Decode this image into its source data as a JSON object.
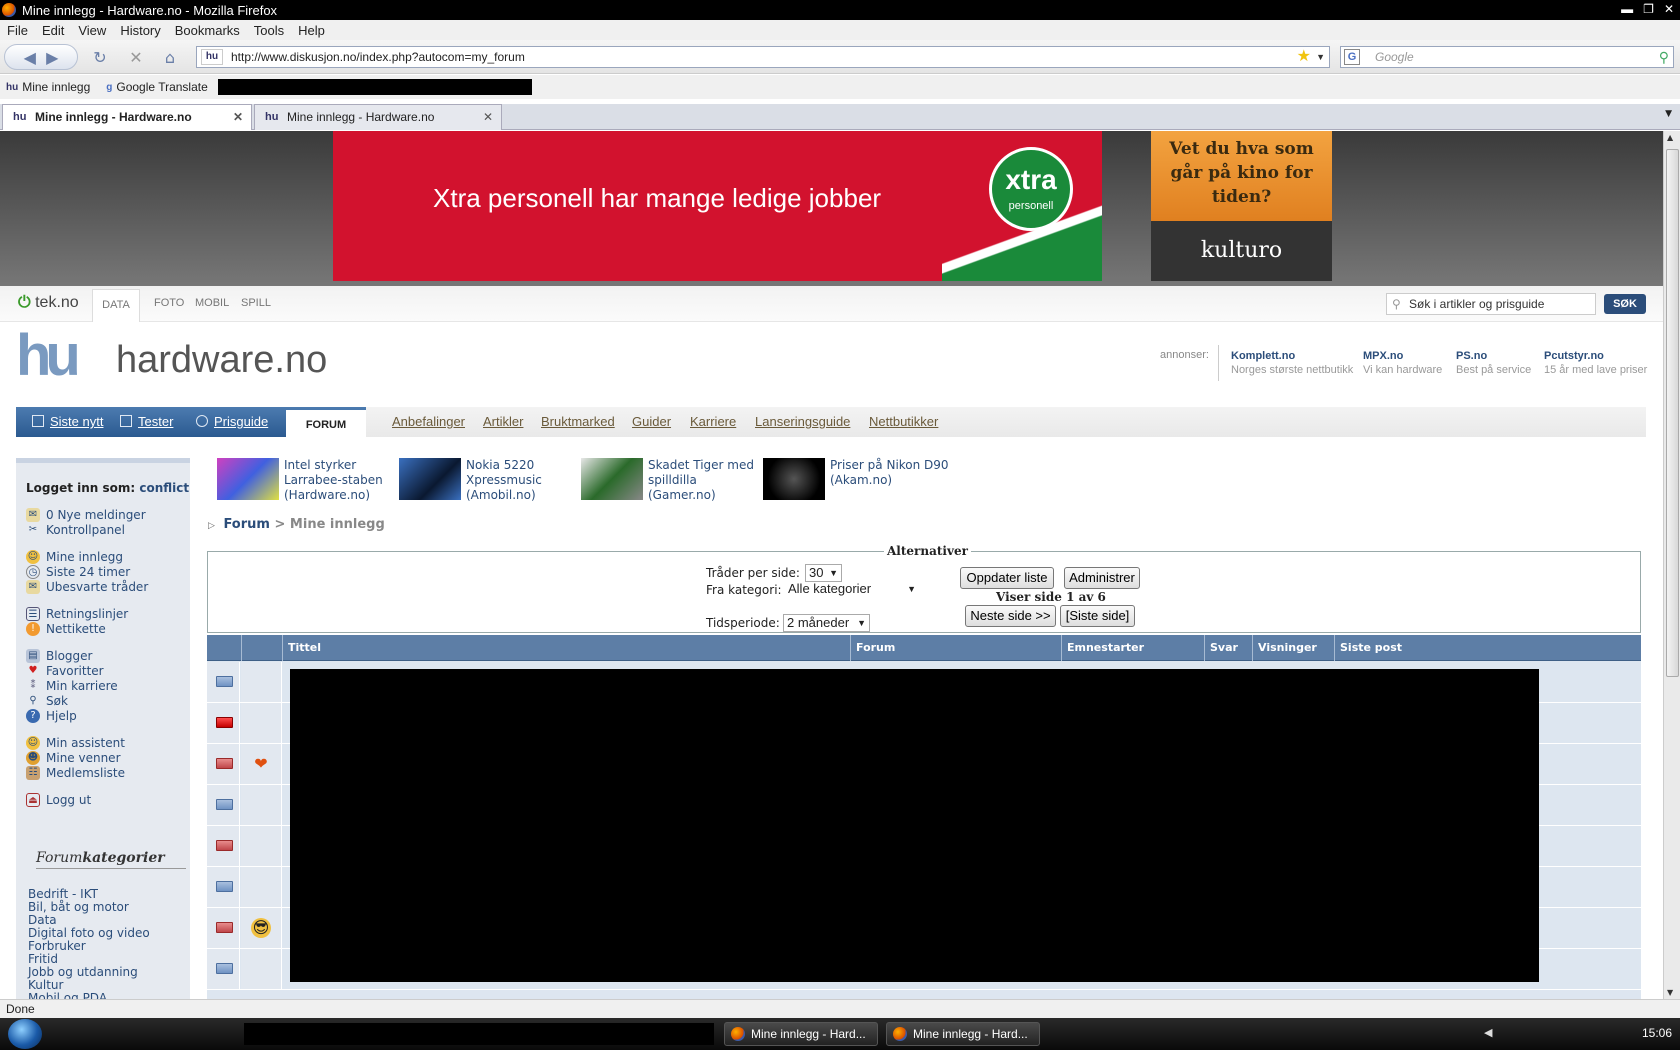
{
  "window": {
    "title": "Mine innlegg - Hardware.no - Mozilla Firefox"
  },
  "menubar": {
    "items": [
      "File",
      "Edit",
      "View",
      "History",
      "Bookmarks",
      "Tools",
      "Help"
    ]
  },
  "navbar": {
    "url": "http://www.diskusjon.no/index.php?autocom=my_forum",
    "search_placeholder": "Google"
  },
  "bookmarks": {
    "items": [
      "Mine innlegg",
      "Google Translate"
    ]
  },
  "tabs": [
    {
      "label": "Mine innlegg - Hardware.no",
      "active": true
    },
    {
      "label": "Mine innlegg - Hardware.no",
      "active": false
    }
  ],
  "ads": {
    "xtra_text": "Xtra personell har mange ledige jobber",
    "xtra_logo_big": "xtra",
    "xtra_logo_small": "personell",
    "kultur_text": "Vet du hva som går på kino for tiden?",
    "kultur_logo": "kulturo"
  },
  "teknav": {
    "logo": "tek.no",
    "sections": [
      "DATA",
      "FOTO",
      "MOBIL",
      "SPILL"
    ],
    "search_placeholder": "Søk i artikler og prisguide",
    "search_button": "SØK"
  },
  "site": {
    "name": "hardware.no"
  },
  "annonser": {
    "label": "annonser:",
    "sponsors": [
      {
        "name": "Komplett.no",
        "desc": "Norges største nettbutikk"
      },
      {
        "name": "MPX.no",
        "desc": "Vi kan hardware"
      },
      {
        "name": "PS.no",
        "desc": "Best på service"
      },
      {
        "name": "Pcutstyr.no",
        "desc": "15 år med lave priser"
      }
    ]
  },
  "mainnav": {
    "blue_items": [
      "Siste nytt",
      "Tester",
      "Prisguide"
    ],
    "active": "FORUM",
    "sub_items": [
      "Anbefalinger",
      "Artikler",
      "Bruktmarked",
      "Guider",
      "Karriere",
      "Lanseringsguide",
      "Nettbutikker"
    ]
  },
  "sidebar": {
    "logged_label": "Logget inn som:",
    "user": "conflict",
    "links": [
      "0 Nye meldinger",
      "Kontrollpanel",
      "Mine innlegg",
      "Siste 24 timer",
      "Ubesvarte tråder",
      "Retningslinjer",
      "Nettikette",
      "Blogger",
      "Favoritter",
      "Min karriere",
      "Søk",
      "Hjelp",
      "Min assistent",
      "Mine venner",
      "Medlemsliste",
      "Logg ut"
    ],
    "categories_header_a": "Forum",
    "categories_header_b": "kategorier",
    "categories": [
      "Bedrift - IKT",
      "Bil, båt og motor",
      "Data",
      "Digital foto og video",
      "Forbruker",
      "Fritid",
      "Jobb og utdanning",
      "Kultur",
      "Mobil og PDA"
    ]
  },
  "news": [
    {
      "title": "Intel styrker Larrabee-staben",
      "source": "(Hardware.no)"
    },
    {
      "title": "Nokia 5220 Xpressmusic",
      "source": "(Amobil.no)"
    },
    {
      "title": "Skadet Tiger med spilldilla",
      "source": "(Gamer.no)"
    },
    {
      "title": "Priser på Nikon D90",
      "source": "(Akam.no)"
    }
  ],
  "breadcrumb": {
    "forum": "Forum",
    "sep": ">",
    "current": "Mine innlegg"
  },
  "alternatives": {
    "legend": "Alternativer",
    "threads_label": "Tråder per side:",
    "threads_value": "30",
    "category_label": "Fra kategori:",
    "category_value": "Alle kategorier",
    "period_label": "Tidsperiode:",
    "period_value": "2 måneder",
    "update_button": "Oppdater liste",
    "admin_button": "Administrer",
    "page_info": "Viser side 1 av 6",
    "next_button": "Neste side >>",
    "last_button": "[Siste side]"
  },
  "table": {
    "columns": [
      "Tittel",
      "Forum",
      "Emnestarter",
      "Svar",
      "Visninger",
      "Siste post"
    ],
    "rows": [
      {
        "folder": "blue",
        "emoticon": ""
      },
      {
        "folder": "hot",
        "emoticon": ""
      },
      {
        "folder": "red",
        "emoticon": "heart"
      },
      {
        "folder": "blue",
        "emoticon": ""
      },
      {
        "folder": "red",
        "emoticon": ""
      },
      {
        "folder": "blue",
        "emoticon": ""
      },
      {
        "folder": "red",
        "emoticon": "cool"
      },
      {
        "folder": "blue",
        "emoticon": ""
      }
    ]
  },
  "statusbar": {
    "text": "Done"
  },
  "taskbar": {
    "tasks": [
      "Mine innlegg - Hard...",
      "Mine innlegg - Hard..."
    ],
    "clock": "15:06"
  }
}
